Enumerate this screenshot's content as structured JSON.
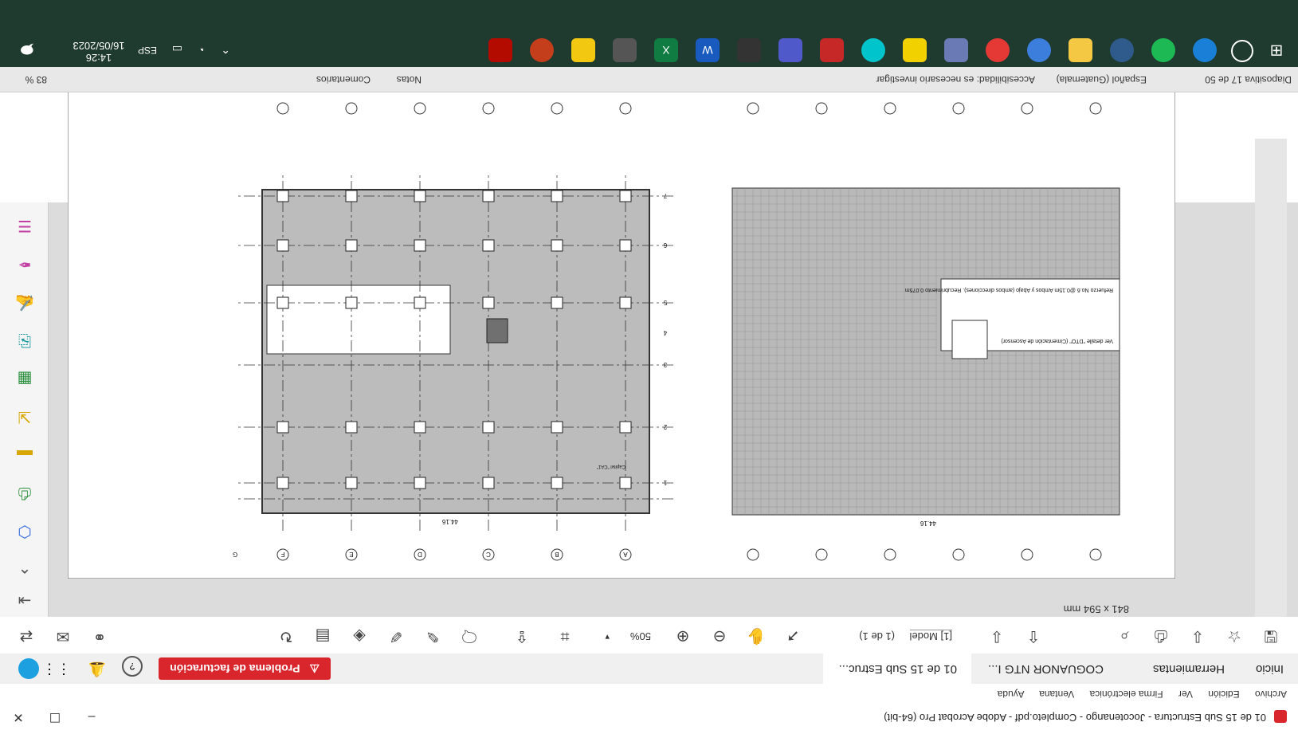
{
  "window": {
    "title": "01 de 15 Sub Estructura - Jocotenango - Completo.pdf - Adobe Acrobat Pro (64-bit)"
  },
  "menu": [
    "Archivo",
    "Edición",
    "Ver",
    "Firma electrónica",
    "Ventana",
    "Ayuda"
  ],
  "tabs": [
    "Inicio",
    "Herramientas",
    "COGUANOR NTG I...",
    "01 de 15 Sub Estruc..."
  ],
  "billing_alert": "Problema de facturación",
  "toolbar": {
    "page_field": "[1] Model",
    "page_count": "(1 de 1)",
    "zoom": "50%"
  },
  "sheet_size": "841 x 594 mm",
  "ppt_status": {
    "slide": "Diapositiva 17 de 50",
    "language": "Español (Guatemala)",
    "accessibility": "Accesibilidad: es necesario investigar",
    "notes": "Notas",
    "comments": "Comentarios",
    "zoom_pct": "83 %"
  },
  "taskbar": {
    "lang": "ESP",
    "time": "14:26",
    "date": "16/05/2023"
  },
  "drawing": {
    "grid_letters": [
      "A",
      "B",
      "C",
      "D",
      "E",
      "F",
      "G"
    ],
    "grid_numbers": [
      "1",
      "2",
      "3",
      "4",
      "5",
      "6",
      "7"
    ],
    "total_dim": "44.16",
    "note_top": "Ver detalle \"DTO\" (Cimentación de Ascensor)",
    "note_rebar": "Refuerzo No.6 @0.15m Ambos y Abajo (ambos direcciones). Recubrimiento 0.075m",
    "capitel": "Capitel \"CA1\""
  },
  "colors": {
    "taskbar": "#1f3a2f",
    "alert": "#d9262c",
    "slab": "#bcbcbc"
  }
}
